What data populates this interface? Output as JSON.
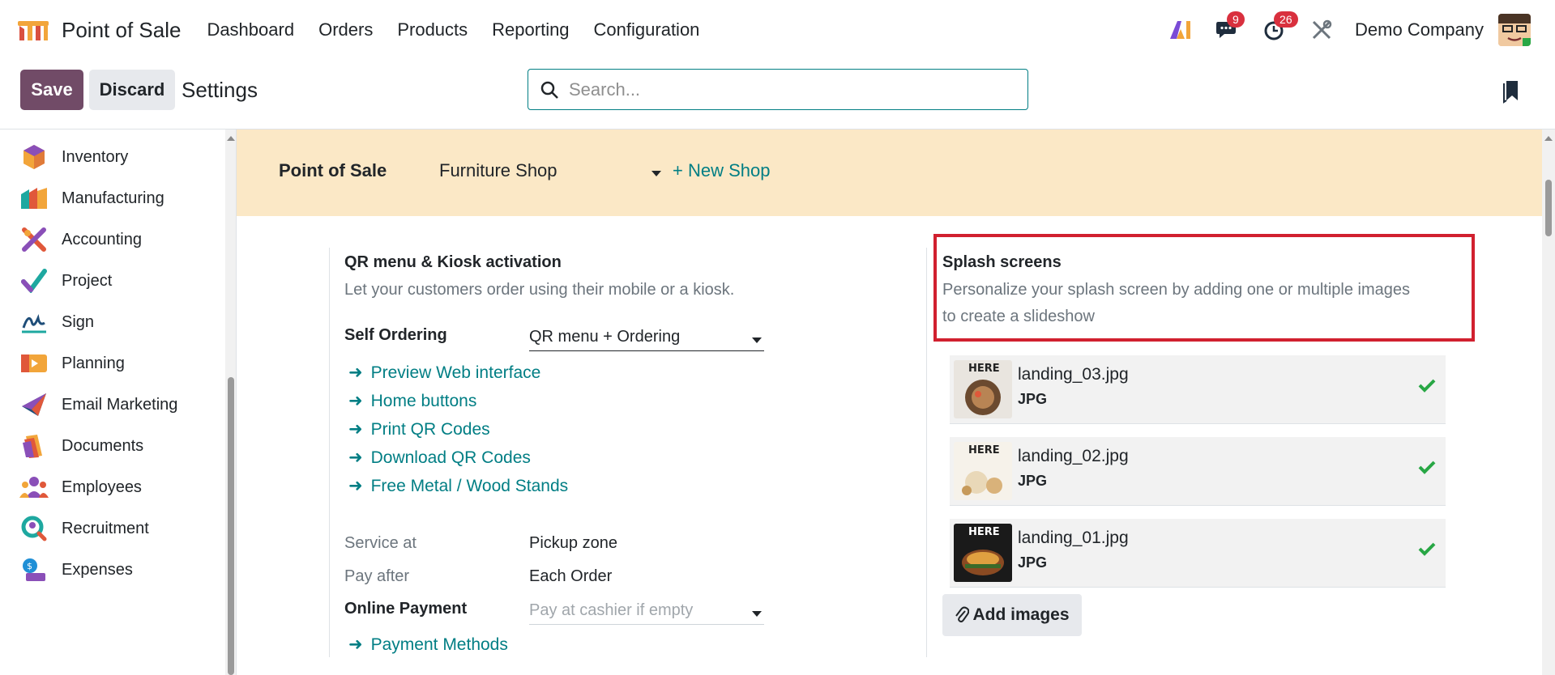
{
  "navbar": {
    "app_name": "Point of Sale",
    "menu": [
      "Dashboard",
      "Orders",
      "Products",
      "Reporting",
      "Configuration"
    ],
    "chat_count": "9",
    "activity_count": "26",
    "company": "Demo Company"
  },
  "control": {
    "save_label": "Save",
    "discard_label": "Discard",
    "breadcrumb": "Settings",
    "search_placeholder": "Search..."
  },
  "sidebar": {
    "items": [
      {
        "label": "Inventory",
        "icon": "inventory-icon"
      },
      {
        "label": "Manufacturing",
        "icon": "manufacturing-icon"
      },
      {
        "label": "Accounting",
        "icon": "accounting-icon"
      },
      {
        "label": "Project",
        "icon": "project-icon"
      },
      {
        "label": "Sign",
        "icon": "sign-icon"
      },
      {
        "label": "Planning",
        "icon": "planning-icon"
      },
      {
        "label": "Email Marketing",
        "icon": "email-marketing-icon"
      },
      {
        "label": "Documents",
        "icon": "documents-icon"
      },
      {
        "label": "Employees",
        "icon": "employees-icon"
      },
      {
        "label": "Recruitment",
        "icon": "recruitment-icon"
      },
      {
        "label": "Expenses",
        "icon": "expenses-icon"
      }
    ]
  },
  "shop_bar": {
    "title": "Point of Sale",
    "selected_shop": "Furniture Shop",
    "new_shop_label": "+ New Shop"
  },
  "qr_section": {
    "title": "QR menu & Kiosk activation",
    "description": "Let your customers order using their mobile or a kiosk.",
    "self_ordering_label": "Self Ordering",
    "self_ordering_value": "QR menu + Ordering",
    "links": [
      "Preview Web interface",
      "Home buttons",
      "Print QR Codes",
      "Download QR Codes",
      "Free Metal / Wood Stands"
    ],
    "service_at_label": "Service at",
    "service_at_value": "Pickup zone",
    "pay_after_label": "Pay after",
    "pay_after_value": "Each Order",
    "online_payment_label": "Online Payment",
    "online_payment_placeholder": "Pay at cashier if empty",
    "payment_methods_link": "Payment Methods"
  },
  "splash_section": {
    "title": "Splash screens",
    "description_line1": "Personalize your splash screen by adding one or multiple images",
    "description_line2": "to create a slideshow",
    "images": [
      {
        "name": "landing_03.jpg",
        "type": "JPG",
        "thumb_text": "HERE"
      },
      {
        "name": "landing_02.jpg",
        "type": "JPG",
        "thumb_text": "HERE"
      },
      {
        "name": "landing_01.jpg",
        "type": "JPG",
        "thumb_text": "HERE"
      }
    ],
    "add_images_label": "Add images"
  },
  "colors": {
    "brand": "#714b67",
    "link": "#017e84",
    "shop_bar": "#fbe8c6",
    "highlight": "#d1202f",
    "check": "#28a745"
  }
}
